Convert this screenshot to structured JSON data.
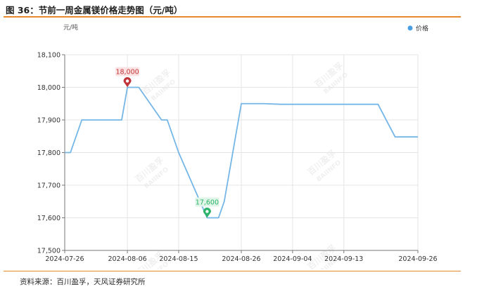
{
  "figure": {
    "title": "图 36：节前一周金属镁价格走势图（元/吨）",
    "source": "资料来源：百川盈孚，天风证券研究所",
    "watermark": [
      "百川盈孚",
      "BAIINFO"
    ]
  },
  "colors": {
    "line": "#74b6e6",
    "legend_dot": "#4a9fe0",
    "rule": "#e8892c",
    "grid": "#e5e5e5",
    "max_marker": "#c0353a",
    "min_marker": "#2eb36a",
    "max_label_bg": "#fbe3e3",
    "min_label_bg": "#dff5e7"
  },
  "chart_data": {
    "type": "line",
    "ylabel": "元/吨",
    "xlabel": "",
    "ylim": [
      17500,
      18100
    ],
    "yticks": [
      17500,
      17600,
      17700,
      17800,
      17900,
      18000,
      18100
    ],
    "ytick_labels": [
      "17,500",
      "17,600",
      "17,700",
      "17,800",
      "17,900",
      "18,000",
      "18,100"
    ],
    "xlim": [
      "2024-07-26",
      "2024-09-26"
    ],
    "xticks": [
      "2024-07-26",
      "2024-08-06",
      "2024-08-15",
      "2024-08-26",
      "2024-09-04",
      "2024-09-13",
      "2024-09-26"
    ],
    "grid": true,
    "legend": "top-right",
    "series": [
      {
        "name": "价格",
        "x": [
          "2024-07-26",
          "2024-07-27",
          "2024-07-29",
          "2024-08-01",
          "2024-08-05",
          "2024-08-06",
          "2024-08-07",
          "2024-08-08",
          "2024-08-12",
          "2024-08-13",
          "2024-08-15",
          "2024-08-20",
          "2024-08-21",
          "2024-08-22",
          "2024-08-23",
          "2024-08-26",
          "2024-08-30",
          "2024-09-02",
          "2024-09-19",
          "2024-09-22",
          "2024-09-26"
        ],
        "y": [
          17800,
          17800,
          17900,
          17900,
          17900,
          18000,
          18000,
          18000,
          17900,
          17900,
          17800,
          17600,
          17600,
          17600,
          17650,
          17950,
          17950,
          17948,
          17948,
          17848,
          17848
        ]
      }
    ],
    "annotations": [
      {
        "kind": "max",
        "label": "18,000",
        "x": "2024-08-06",
        "y": 18000
      },
      {
        "kind": "min",
        "label": "17,600",
        "x": "2024-08-20",
        "y": 17600
      }
    ]
  }
}
